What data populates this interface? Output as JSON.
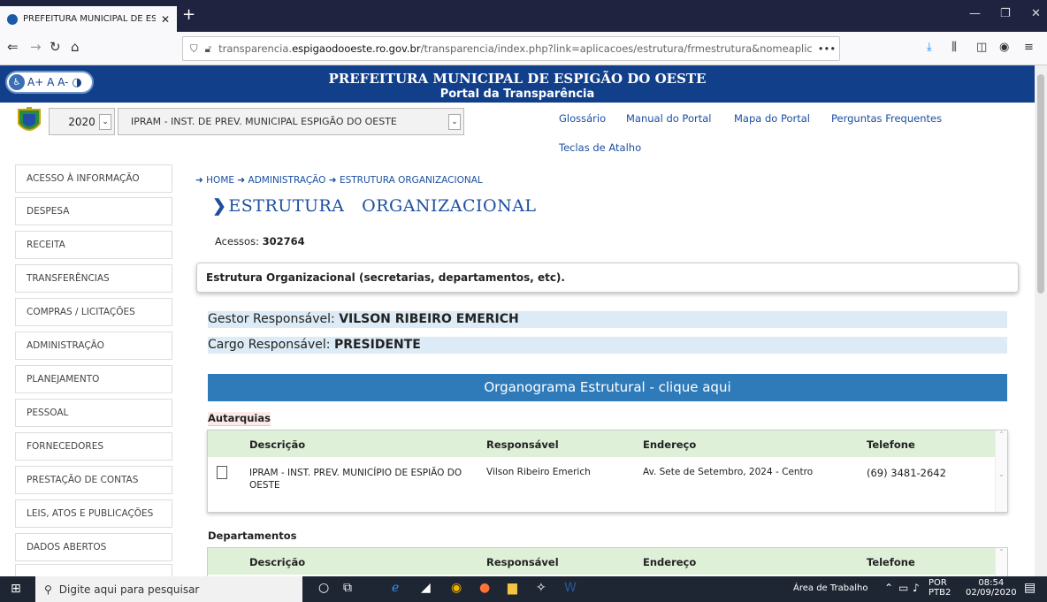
{
  "browser": {
    "tab_title": "PREFEITURA MUNICIPAL DE ESI",
    "url_prefix": "transparencia.",
    "url_domain": "espigaodooeste.ro.gov.br",
    "url_path": "/transparencia/index.php?link=aplicacoes/estrutura/frmestrutura&nomeaplic",
    "url_more": "•••"
  },
  "header": {
    "title": "PREFEITURA MUNICIPAL DE ESPIGÃO DO OESTE",
    "subtitle": "Portal da Transparência",
    "accessibility": "A+ A A-"
  },
  "selectors": {
    "year": "2020",
    "org": "IPRAM - INST. DE PREV. MUNICIPAL ESPIGÃO DO OESTE"
  },
  "top_links": {
    "glossario": "Glossário",
    "manual": "Manual do Portal",
    "mapa": "Mapa do Portal",
    "perguntas": "Perguntas Frequentes",
    "teclas": "Teclas de Atalho"
  },
  "sidebar": {
    "items": [
      {
        "label": "ACESSO À INFORMAÇÃO"
      },
      {
        "label": "DESPESA"
      },
      {
        "label": "RECEITA"
      },
      {
        "label": "TRANSFERÊNCIAS"
      },
      {
        "label": "COMPRAS / LICITAÇÕES"
      },
      {
        "label": "ADMINISTRAÇÃO"
      },
      {
        "label": "PLANEJAMENTO"
      },
      {
        "label": "PESSOAL"
      },
      {
        "label": "FORNECEDORES"
      },
      {
        "label": "PRESTAÇÃO DE CONTAS"
      },
      {
        "label": "LEIS, ATOS E PUBLICAÇÕES"
      },
      {
        "label": "DADOS ABERTOS"
      }
    ]
  },
  "breadcrumb": {
    "home": "HOME",
    "adm": "ADMINISTRAÇÃO",
    "current": "ESTRUTURA ORGANIZACIONAL"
  },
  "page": {
    "title": "ESTRUTURA   ORGANIZACIONAL",
    "acessos_label": "Acessos:",
    "acessos_value": "302764",
    "description": "Estrutura Organizacional (secretarias, departamentos, etc).",
    "gestor_label": "Gestor Responsável:",
    "gestor_value": "VILSON RIBEIRO EMERICH",
    "cargo_label": "Cargo Responsável:",
    "cargo_value": "PRESIDENTE",
    "organograma": "Organograma Estrutural - clique aqui"
  },
  "table": {
    "headers": [
      "Descrição",
      "Responsável",
      "Endereço",
      "Telefone"
    ]
  },
  "autarquias": {
    "title": "Autarquias",
    "rows": [
      {
        "descricao1": "IPRAM - INST. PREV. MUNICÍPIO DE ESPIÃO DO",
        "descricao2": "OESTE",
        "responsavel": "Vilson Ribeiro Emerich",
        "endereco": "Av. Sete de Setembro, 2024 - Centro",
        "telefone": "(69) 3481-2642"
      }
    ]
  },
  "departamentos": {
    "title": "Departamentos"
  },
  "taskbar": {
    "search_placeholder": "Digite aqui para pesquisar",
    "desktop": "Área de Trabalho",
    "lang1": "POR",
    "lang2": "PTB2",
    "time": "08:54",
    "date": "02/09/2020"
  },
  "colors": {
    "header_blue": "#123f8a",
    "link_blue": "#1b4fa0",
    "button_blue": "#2f7ab9",
    "table_head_green": "#dff0d8",
    "info_bg": "#dcebf5"
  }
}
